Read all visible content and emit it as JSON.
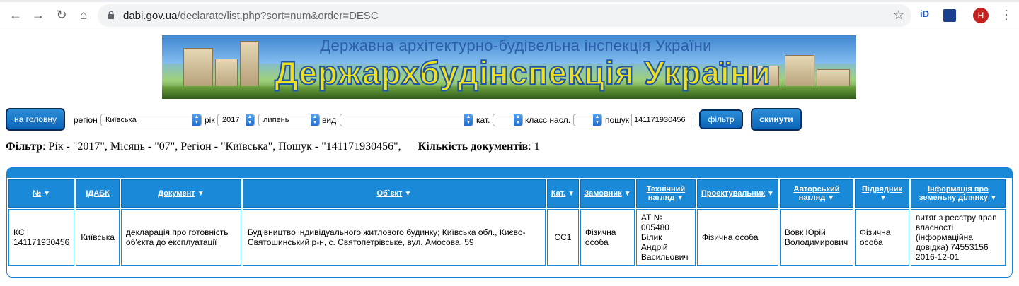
{
  "browser": {
    "url_domain": "dabi.gov.ua",
    "url_path": "/declarate/list.php?sort=num&order=DESC",
    "avatar_letter": "H",
    "ext1": "iD"
  },
  "banner": {
    "subtitle": "Державна архітектурно-будівельна інспекція України",
    "title": "Держархбудінспекція України"
  },
  "filters": {
    "home_button": "на головну",
    "region_label": "регіон",
    "region_value": "Київська",
    "year_label": "рік",
    "year_value": "2017",
    "month_value": "липень",
    "type_label": "вид",
    "type_value": "",
    "cat_label": "кат.",
    "cat_value": "",
    "class_label": "класс насл.",
    "class_value": "",
    "search_label": "пошук",
    "search_value": "141171930456",
    "filter_button": "фільтр",
    "reset_button": "скинути"
  },
  "summary": {
    "filter_label": "Фільтр",
    "filter_text": ": Рік - \"2017\", Місяць - \"07\", Регіон - \"Київська\", Пошук - \"141171930456\",",
    "count_label": "Кількість документів",
    "count_value": ": 1"
  },
  "table": {
    "headers": [
      "№",
      "ІДАБК",
      "Документ",
      "Об`єкт",
      "Кат.",
      "Замовник",
      "Технічний нагляд",
      "Проектувальник",
      "Авторський нагляд",
      "Підрядник",
      "Інформація про земельну ділянку"
    ],
    "row": {
      "num": "КС 141171930456",
      "idabk": "Київська",
      "document": "декларація про готовність об'єкта до експлуатації",
      "object": "Будівництво індивідуального житлового будинку; Київська обл., Києво-Святошинський р-н, с. Святопетрівське, вул. Амосова, 59",
      "cat": "СС1",
      "customer": "Фізична особа",
      "tech_supervision": "АТ № 005480 Білик Андрій Васильович",
      "designer": "Фізична особа",
      "author_supervision": "Вовк Юрій Володимирович",
      "contractor": "Фізична особа",
      "land_info": "витяг з реєстру прав власності (інформаційна довідка) 74553156 2016-12-01"
    }
  }
}
